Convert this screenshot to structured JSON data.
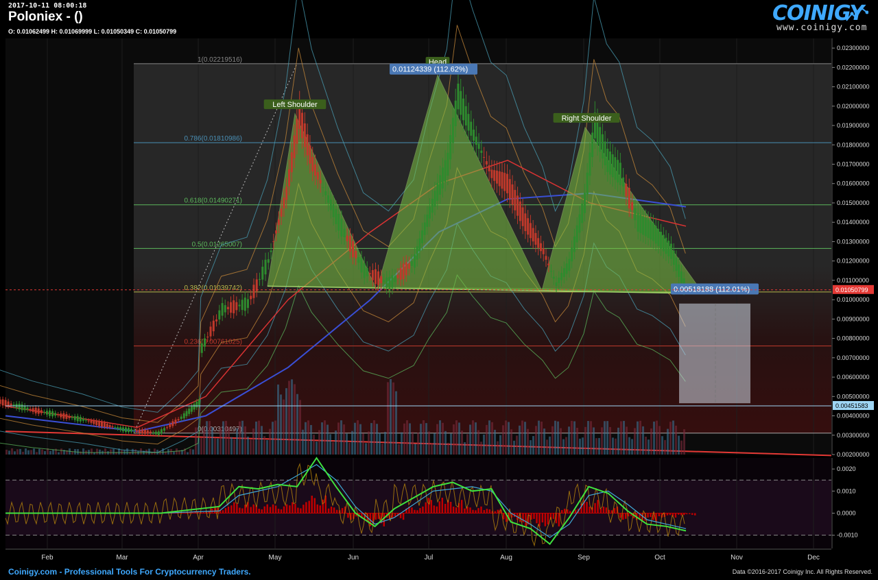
{
  "header": {
    "timestamp": "2017-10-11 08:00:18",
    "exchange_title": "Poloniex -  ()",
    "ohlc": "O: 0.01062499 H: 0.01069999 L: 0.01050349 C: 0.01050799",
    "logo_text": "COINIGY",
    "logo_url": "www.coinigy.com"
  },
  "footer": {
    "left": "Coinigy.com - Professional Tools For Cryptocurrency Traders.",
    "right": "Data ©2016-2017 Coinigy Inc. All Rights Reserved."
  },
  "colors": {
    "candle_up": "#2e8b2e",
    "candle_down": "#c0392b",
    "fib_blue": "#4a8fb5",
    "fib_green": "#5cb85c",
    "price_tag": "#e53935",
    "pattern_fill": "#7cc243",
    "ma_blue": "#3a4fd6",
    "ma_red": "#d93333",
    "macd_fast": "#3fe23f",
    "macd_slow": "#3fa9d6",
    "hist": "#c00000",
    "signal_aux": "#b8860b"
  },
  "chart_data": {
    "type": "line",
    "x_tick_labels": [
      "Feb",
      "Mar",
      "Apr",
      "May",
      "Jun",
      "Jul",
      "Aug",
      "Sep",
      "Oct",
      "Nov",
      "Dec"
    ],
    "y_tick_labels": [
      "0.02300000",
      "0.02200000",
      "0.02100000",
      "0.02000000",
      "0.01900000",
      "0.01800000",
      "0.01700000",
      "0.01600000",
      "0.01500000",
      "0.01400000",
      "0.01300000",
      "0.01200000",
      "0.01100000",
      "0.01000000",
      "0.00900000",
      "0.00800000",
      "0.00700000",
      "0.00600000",
      "0.00500000",
      "0.00400000",
      "0.00300000",
      "0.00200000"
    ],
    "ylim": [
      0.002,
      0.0235
    ],
    "price_path": [
      [
        "Jan 10",
        0.0048
      ],
      [
        "Jan 25",
        0.0043
      ],
      [
        "Feb 15",
        0.0038
      ],
      [
        "Mar 1",
        0.0033
      ],
      [
        "Mar 15",
        0.0031
      ],
      [
        "Mar 25",
        0.004
      ],
      [
        "Mar 31",
        0.0047
      ],
      [
        "Apr 2",
        0.0075
      ],
      [
        "Apr 10",
        0.0095
      ],
      [
        "Apr 20",
        0.0098
      ],
      [
        "Apr 28",
        0.012
      ],
      [
        "May 5",
        0.0155
      ],
      [
        "May 10",
        0.0195
      ],
      [
        "May 15",
        0.017
      ],
      [
        "May 25",
        0.014
      ],
      [
        "Jun 5",
        0.0115
      ],
      [
        "Jun 15",
        0.0108
      ],
      [
        "Jun 25",
        0.012
      ],
      [
        "Jul 1",
        0.0145
      ],
      [
        "Jul 8",
        0.017
      ],
      [
        "Jul 12",
        0.0205
      ],
      [
        "Jul 18",
        0.0185
      ],
      [
        "Jul 25",
        0.0165
      ],
      [
        "Aug 1",
        0.016
      ],
      [
        "Aug 8",
        0.014
      ],
      [
        "Aug 15",
        0.0125
      ],
      [
        "Aug 20",
        0.0108
      ],
      [
        "Aug 25",
        0.0118
      ],
      [
        "Sep 1",
        0.015
      ],
      [
        "Sep 5",
        0.019
      ],
      [
        "Sep 10",
        0.0172
      ],
      [
        "Sep 15",
        0.0165
      ],
      [
        "Sep 22",
        0.014
      ],
      [
        "Sep 28",
        0.0135
      ],
      [
        "Oct 5",
        0.0125
      ],
      [
        "Oct 11",
        0.0105
      ]
    ],
    "fib_levels": [
      {
        "label": "1(0.02219516)",
        "value": 0.02219516
      },
      {
        "label": "0.786(0.01810986)",
        "value": 0.01810986
      },
      {
        "label": "0.618(0.01490271)",
        "value": 0.01490271
      },
      {
        "label": "0.5(0.01265007)",
        "value": 0.01265007
      },
      {
        "label": "0.382(0.01039742)",
        "value": 0.01039742
      },
      {
        "label": "0.236(0.00761025)",
        "value": 0.00761025
      },
      {
        "label": "0(0.00310497)",
        "value": 0.00310497
      }
    ],
    "annotations": [
      {
        "text": "Left Shoulder",
        "price": 0.0196
      },
      {
        "text": "Head",
        "price": 0.0218
      },
      {
        "text": "Right Shoulder",
        "price": 0.0189
      }
    ],
    "measure_labels": [
      {
        "text": "0.01124339 (112.62%)"
      },
      {
        "text": "0.00518188 (112.01%)"
      }
    ],
    "price_tags": [
      {
        "text": "0.01050799",
        "value": 0.01050799,
        "color": "#e53935"
      },
      {
        "text": "0.00451583",
        "value": 0.00451583,
        "color": "#9fd6f5"
      }
    ],
    "macd": {
      "ylim": [
        -0.0016,
        0.0025
      ],
      "tick_labels": [
        "0.0020",
        "0.0010",
        "0.0000",
        "-0.0010"
      ],
      "fast": [
        [
          0,
          0
        ],
        [
          8,
          0
        ],
        [
          11,
          0.0003
        ],
        [
          12,
          0.0012
        ],
        [
          13,
          0.0011
        ],
        [
          14,
          0.0013
        ],
        [
          15,
          0.0012
        ],
        [
          16,
          0.0025
        ],
        [
          17,
          0.0012
        ],
        [
          18,
          0
        ],
        [
          19,
          -0.0006
        ],
        [
          20,
          0.0002
        ],
        [
          22,
          0.0012
        ],
        [
          23,
          0.0014
        ],
        [
          24,
          0.001
        ],
        [
          25,
          0.0011
        ],
        [
          26,
          -0.0004
        ],
        [
          27,
          -0.0007
        ],
        [
          28,
          -0.0014
        ],
        [
          29,
          -0.0002
        ],
        [
          30,
          0.0012
        ],
        [
          31,
          0.0009
        ],
        [
          32,
          0.0001
        ],
        [
          33,
          -0.0005
        ],
        [
          34,
          -0.0006
        ],
        [
          35,
          -0.0008
        ]
      ],
      "slow": [
        [
          0,
          0
        ],
        [
          8,
          0
        ],
        [
          11,
          0.0001
        ],
        [
          12,
          0.0008
        ],
        [
          14,
          0.0012
        ],
        [
          16,
          0.0022
        ],
        [
          17,
          0.0015
        ],
        [
          18,
          0.0003
        ],
        [
          19,
          -0.0005
        ],
        [
          20,
          -0.0002
        ],
        [
          22,
          0.001
        ],
        [
          24,
          0.0012
        ],
        [
          25,
          0.001
        ],
        [
          26,
          0
        ],
        [
          27,
          -0.0005
        ],
        [
          28,
          -0.0011
        ],
        [
          29,
          -0.0005
        ],
        [
          30,
          0.0008
        ],
        [
          31,
          0.001
        ],
        [
          32,
          0.0004
        ],
        [
          33,
          -0.0003
        ],
        [
          34,
          -0.0005
        ],
        [
          35,
          -0.0007
        ]
      ],
      "histogram": [
        0,
        0,
        0,
        0,
        0,
        0,
        0,
        0,
        0,
        5e-05,
        0.0001,
        0.0003,
        0.0005,
        0.0004,
        0.0004,
        0.0005,
        0.0008,
        0.0003,
        -0.0003,
        -0.0006,
        -0.0003,
        0.0003,
        0.0007,
        0.0006,
        0.0003,
        0.0002,
        -0.0004,
        -0.0006,
        -0.0006,
        0.0002,
        0.0006,
        0.0003,
        -0.0003,
        -0.0004,
        -0.0002,
        -0.0001
      ]
    }
  }
}
